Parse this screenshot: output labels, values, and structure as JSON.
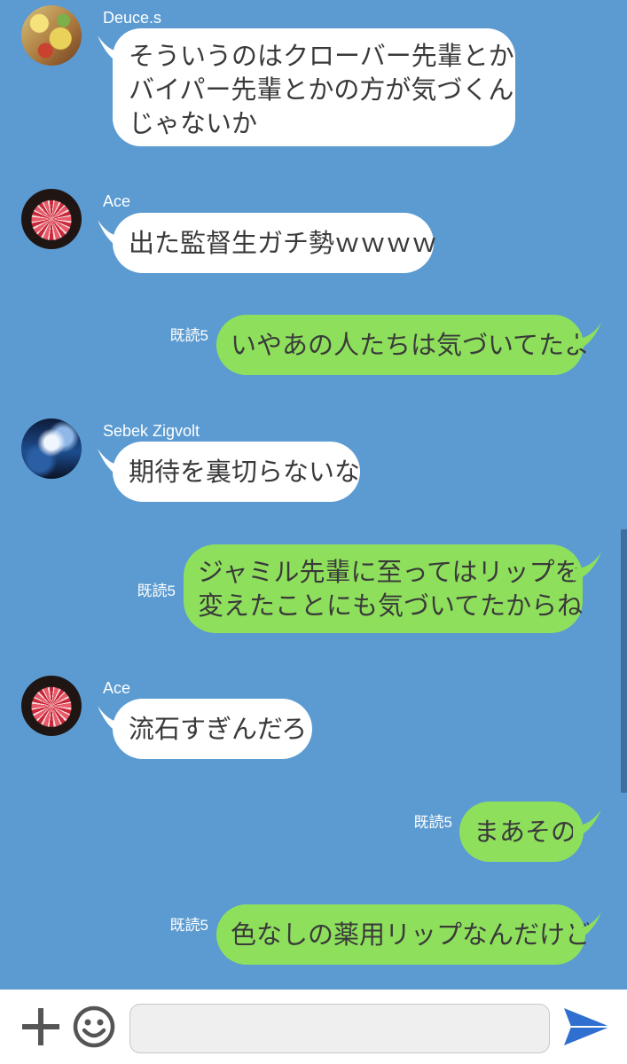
{
  "messages": [
    {
      "sender": "Deuce.s",
      "lines": [
        "そういうのはクローバー先輩とか",
        "バイパー先輩とかの方が気づくん",
        "じゃないか"
      ]
    },
    {
      "sender": "Ace",
      "text": "出た監督生ガチ勢ｗｗｗｗ"
    },
    {
      "read": "既読5",
      "text": "いやあの人たちは気づいてたよ"
    },
    {
      "sender": "Sebek Zigvolt",
      "text": "期待を裏切らないな"
    },
    {
      "read": "既読5",
      "lines": [
        "ジャミル先輩に至ってはリップを",
        "変えたことにも気づいてたからね"
      ]
    },
    {
      "sender": "Ace",
      "text": "流石すぎんだろ"
    },
    {
      "read": "既読5",
      "text": "まあその"
    },
    {
      "read": "既読5",
      "text": "色なしの薬用リップなんだけど"
    }
  ],
  "input": {
    "value": ""
  },
  "icons": {
    "add": "plus-icon",
    "emoji": "emoji-icon",
    "send": "send-icon"
  },
  "colors": {
    "background": "#5b9bd1",
    "incoming_bubble": "#ffffff",
    "outgoing_bubble": "#8ee05c",
    "send_icon": "#2f6fd0"
  }
}
